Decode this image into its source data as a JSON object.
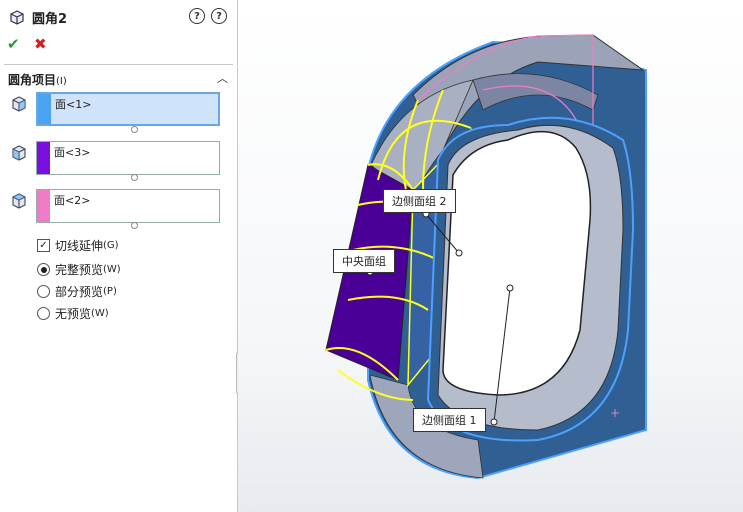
{
  "panel": {
    "title": "圆角2",
    "help_icon": "help-icon",
    "section_title": "圆角项目",
    "section_suffix": "(I)",
    "faces": [
      {
        "label": "面<1>",
        "color": "#4aa3f0",
        "selected": true
      },
      {
        "label": "面<3>",
        "color": "#7a10e0",
        "selected": false
      },
      {
        "label": "面<2>",
        "color": "#f07cc8",
        "selected": false
      }
    ],
    "tangent_label": "切线延伸",
    "tangent_key": "(G)",
    "tangent_checked": true,
    "preview_options": [
      {
        "label": "完整预览",
        "key": "(W)",
        "selected": true
      },
      {
        "label": "部分预览",
        "key": "(P)",
        "selected": false
      },
      {
        "label": "无预览",
        "key": "(W)",
        "selected": false
      }
    ]
  },
  "viewport": {
    "callouts": {
      "side_group_2": "边侧面组 2",
      "center_group": "中央面组",
      "side_group_1": "边侧面组 1"
    },
    "colors": {
      "model": "#2f5f93",
      "highlight": "#ffff20",
      "center_face": "#4a0096",
      "pink": "#f07cc8"
    }
  }
}
